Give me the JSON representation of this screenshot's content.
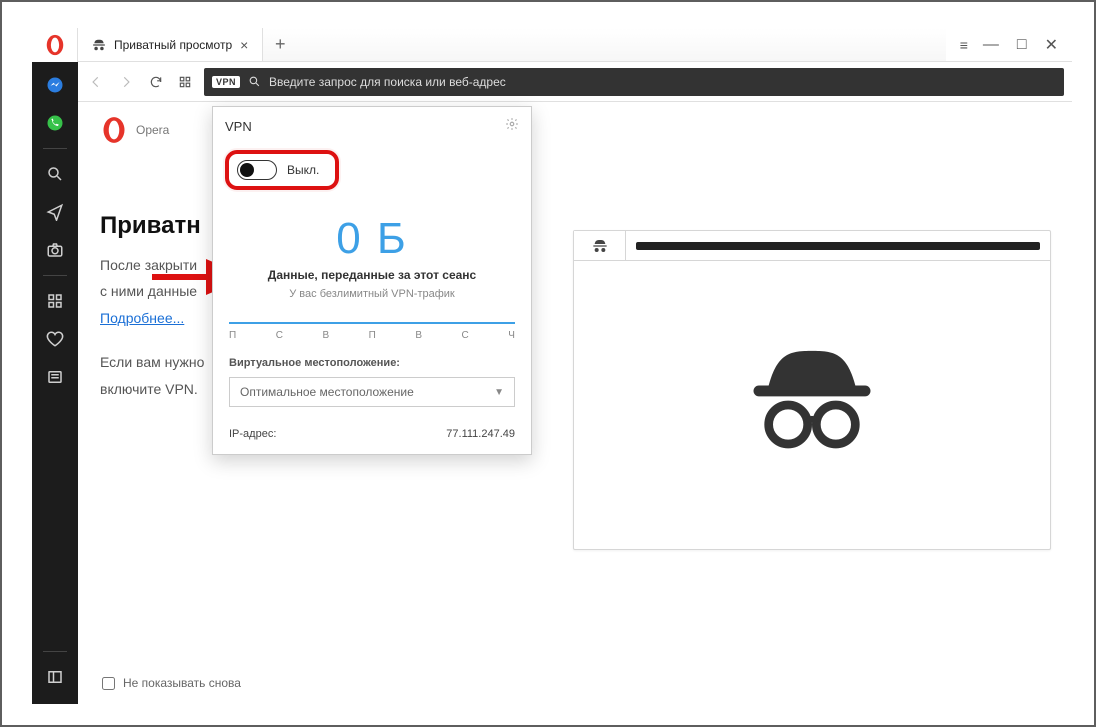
{
  "titlebar": {
    "tab_title": "Приватный просмотр",
    "new_tab_label": "+",
    "win_minimize": "—",
    "win_maximize": "□",
    "win_close": "✕"
  },
  "sidebar": {
    "items": [
      {
        "name": "messenger-icon"
      },
      {
        "name": "whatsapp-icon"
      },
      {
        "name": "search-icon"
      },
      {
        "name": "send-icon"
      },
      {
        "name": "camera-icon"
      },
      {
        "name": "speeddial-icon"
      },
      {
        "name": "heart-icon"
      },
      {
        "name": "news-icon"
      }
    ]
  },
  "addressbar": {
    "vpn_badge": "VPN",
    "placeholder": "Введите запрос для поиска или веб-адрес"
  },
  "brand": "Opera",
  "page": {
    "heading": "Приватн",
    "para1_a": "После закрыти",
    "para1_b": "с ними данные",
    "learn_more": "Подробнее...",
    "para2_a": "Если вам нужно",
    "para2_b": "включите VPN.",
    "dont_show": "Не показывать снова"
  },
  "vpn": {
    "title": "VPN",
    "toggle_label": "Выкл.",
    "data_value": "0 Б",
    "data_caption": "Данные, переданные за этот сеанс",
    "data_sub": "У вас безлимитный VPN-трафик",
    "virtual_location_label": "Виртуальное местоположение:",
    "virtual_location_value": "Оптимальное местоположение",
    "ip_label": "IP-адрес:",
    "ip_value": "77.111.247.49"
  },
  "chart_data": {
    "type": "bar",
    "categories": [
      "П",
      "С",
      "В",
      "П",
      "В",
      "С",
      "Ч"
    ],
    "values": [
      0,
      0,
      0,
      0,
      0,
      0,
      0
    ],
    "title": "",
    "xlabel": "",
    "ylabel": "",
    "ylim": [
      0,
      1
    ]
  }
}
